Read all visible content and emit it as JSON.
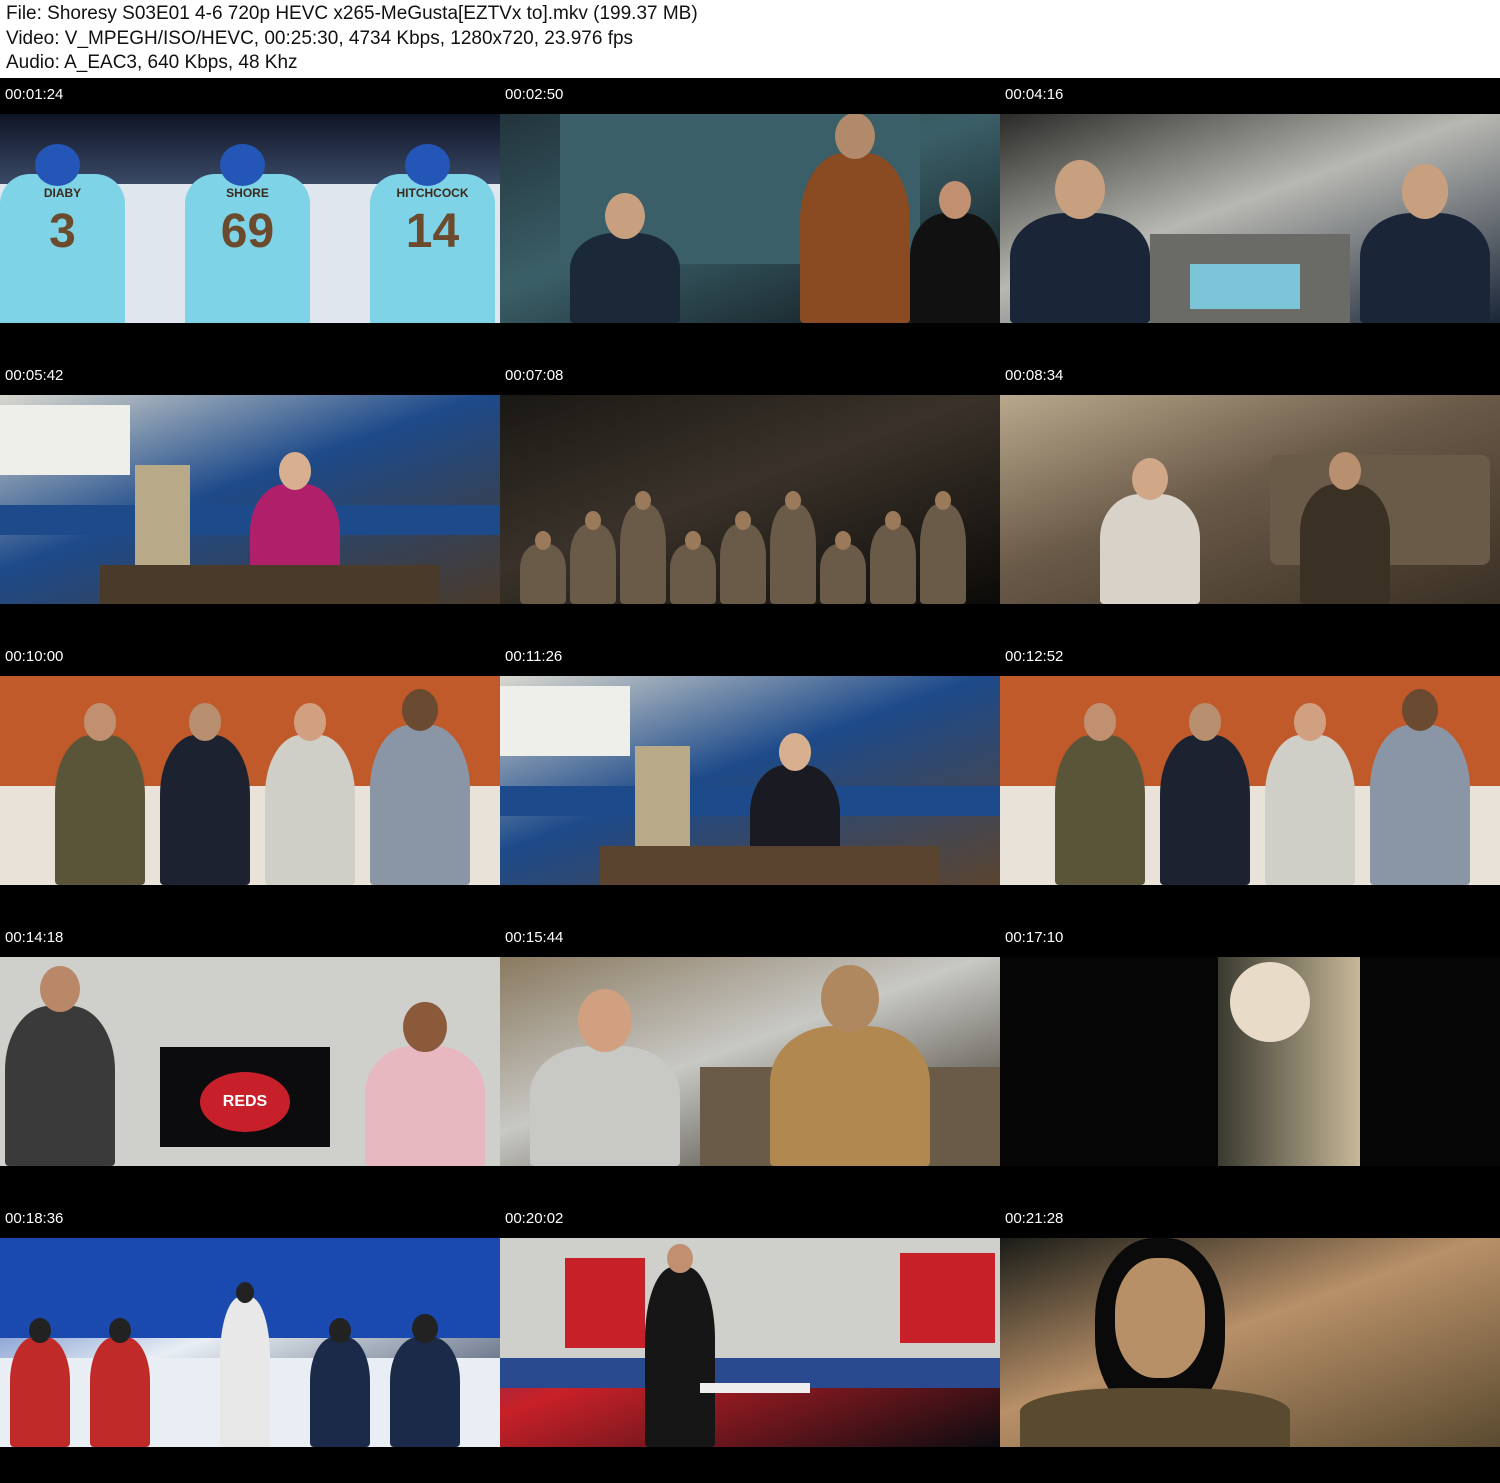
{
  "header": {
    "file_line": "File: Shoresy S03E01 4-6 720p HEVC x265-MeGusta[EZTVx to].mkv (199.37 MB)",
    "video_line": "Video: V_MPEGH/ISO/HEVC, 00:25:30, 4734 Kbps, 1280x720, 23.976 fps",
    "audio_line": "Audio: A_EAC3, 640 Kbps, 48 Khz"
  },
  "thumbnails": [
    {
      "time": "00:01:24",
      "theme": "hockey-bench",
      "colors": [
        "#0b0f1c",
        "#dfe6ee",
        "#7fd3e6",
        "#6b4a2e"
      ],
      "jerseys": [
        "DIABY",
        "SHORE",
        "HITCHCOCK"
      ],
      "numbers": [
        "3",
        "69",
        "14"
      ]
    },
    {
      "time": "00:02:50",
      "theme": "locker-room-teal",
      "colors": [
        "#22343c",
        "#3b5f68",
        "#8a4a22",
        "#0d1418"
      ]
    },
    {
      "time": "00:04:16",
      "theme": "locker-room-wide",
      "colors": [
        "#2a2a28",
        "#b8b8b2",
        "#7cc4d8",
        "#1a2638"
      ]
    },
    {
      "time": "00:05:42",
      "theme": "office-woman",
      "colors": [
        "#d9d8cf",
        "#1d4a8a",
        "#b0206a",
        "#4a3a2a"
      ]
    },
    {
      "time": "00:07:08",
      "theme": "bar-crowd",
      "colors": [
        "#1a1814",
        "#3a322a",
        "#6a5a48",
        "#0c0a08"
      ]
    },
    {
      "time": "00:08:34",
      "theme": "living-room",
      "colors": [
        "#b8a88c",
        "#6a5a48",
        "#d8d2c8",
        "#3a3024"
      ]
    },
    {
      "time": "00:10:00",
      "theme": "kitchen-four",
      "colors": [
        "#c05a2a",
        "#4a4a3a",
        "#cfcfc8",
        "#e8e2d8"
      ]
    },
    {
      "time": "00:11:26",
      "theme": "office-woman-2",
      "colors": [
        "#d9d8cf",
        "#1d4a8a",
        "#1a1a22",
        "#5a4430"
      ]
    },
    {
      "time": "00:12:52",
      "theme": "kitchen-four-2",
      "colors": [
        "#c05a2a",
        "#4a4a3a",
        "#cfcfc8",
        "#e8e2d8"
      ]
    },
    {
      "time": "00:14:18",
      "theme": "tv-reds",
      "colors": [
        "#3a3a3c",
        "#c8202a",
        "#e8b8c0",
        "#111111"
      ],
      "tv_text": "REDS"
    },
    {
      "time": "00:15:44",
      "theme": "couch-two",
      "colors": [
        "#8a7a60",
        "#c8c8c4",
        "#b08850",
        "#2a2418"
      ]
    },
    {
      "time": "00:17:10",
      "theme": "ad-blonde",
      "colors": [
        "#050505",
        "#e8dcc8",
        "#c8a880",
        "#4a4a30"
      ]
    },
    {
      "time": "00:18:36",
      "theme": "faceoff",
      "colors": [
        "#1a4ab0",
        "#e8eef4",
        "#c02a28",
        "#1a2a48"
      ]
    },
    {
      "time": "00:20:02",
      "theme": "reds-locker",
      "colors": [
        "#2a4a90",
        "#c82028",
        "#3a3a3a",
        "#0c0c10"
      ]
    },
    {
      "time": "00:21:28",
      "theme": "closeup-man",
      "colors": [
        "#1a1c18",
        "#b89068",
        "#0a0a0a",
        "#5a4a30"
      ]
    }
  ]
}
